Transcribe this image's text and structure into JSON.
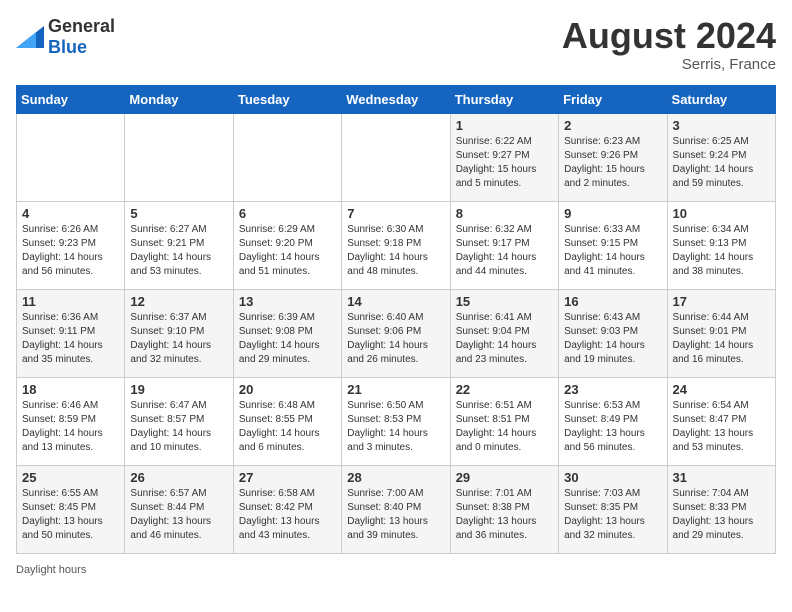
{
  "header": {
    "logo_general": "General",
    "logo_blue": "Blue",
    "month_year": "August 2024",
    "location": "Serris, France"
  },
  "days_of_week": [
    "Sunday",
    "Monday",
    "Tuesday",
    "Wednesday",
    "Thursday",
    "Friday",
    "Saturday"
  ],
  "weeks": [
    [
      {
        "day": "",
        "info": ""
      },
      {
        "day": "",
        "info": ""
      },
      {
        "day": "",
        "info": ""
      },
      {
        "day": "",
        "info": ""
      },
      {
        "day": "1",
        "info": "Sunrise: 6:22 AM\nSunset: 9:27 PM\nDaylight: 15 hours and 5 minutes."
      },
      {
        "day": "2",
        "info": "Sunrise: 6:23 AM\nSunset: 9:26 PM\nDaylight: 15 hours and 2 minutes."
      },
      {
        "day": "3",
        "info": "Sunrise: 6:25 AM\nSunset: 9:24 PM\nDaylight: 14 hours and 59 minutes."
      }
    ],
    [
      {
        "day": "4",
        "info": "Sunrise: 6:26 AM\nSunset: 9:23 PM\nDaylight: 14 hours and 56 minutes."
      },
      {
        "day": "5",
        "info": "Sunrise: 6:27 AM\nSunset: 9:21 PM\nDaylight: 14 hours and 53 minutes."
      },
      {
        "day": "6",
        "info": "Sunrise: 6:29 AM\nSunset: 9:20 PM\nDaylight: 14 hours and 51 minutes."
      },
      {
        "day": "7",
        "info": "Sunrise: 6:30 AM\nSunset: 9:18 PM\nDaylight: 14 hours and 48 minutes."
      },
      {
        "day": "8",
        "info": "Sunrise: 6:32 AM\nSunset: 9:17 PM\nDaylight: 14 hours and 44 minutes."
      },
      {
        "day": "9",
        "info": "Sunrise: 6:33 AM\nSunset: 9:15 PM\nDaylight: 14 hours and 41 minutes."
      },
      {
        "day": "10",
        "info": "Sunrise: 6:34 AM\nSunset: 9:13 PM\nDaylight: 14 hours and 38 minutes."
      }
    ],
    [
      {
        "day": "11",
        "info": "Sunrise: 6:36 AM\nSunset: 9:11 PM\nDaylight: 14 hours and 35 minutes."
      },
      {
        "day": "12",
        "info": "Sunrise: 6:37 AM\nSunset: 9:10 PM\nDaylight: 14 hours and 32 minutes."
      },
      {
        "day": "13",
        "info": "Sunrise: 6:39 AM\nSunset: 9:08 PM\nDaylight: 14 hours and 29 minutes."
      },
      {
        "day": "14",
        "info": "Sunrise: 6:40 AM\nSunset: 9:06 PM\nDaylight: 14 hours and 26 minutes."
      },
      {
        "day": "15",
        "info": "Sunrise: 6:41 AM\nSunset: 9:04 PM\nDaylight: 14 hours and 23 minutes."
      },
      {
        "day": "16",
        "info": "Sunrise: 6:43 AM\nSunset: 9:03 PM\nDaylight: 14 hours and 19 minutes."
      },
      {
        "day": "17",
        "info": "Sunrise: 6:44 AM\nSunset: 9:01 PM\nDaylight: 14 hours and 16 minutes."
      }
    ],
    [
      {
        "day": "18",
        "info": "Sunrise: 6:46 AM\nSunset: 8:59 PM\nDaylight: 14 hours and 13 minutes."
      },
      {
        "day": "19",
        "info": "Sunrise: 6:47 AM\nSunset: 8:57 PM\nDaylight: 14 hours and 10 minutes."
      },
      {
        "day": "20",
        "info": "Sunrise: 6:48 AM\nSunset: 8:55 PM\nDaylight: 14 hours and 6 minutes."
      },
      {
        "day": "21",
        "info": "Sunrise: 6:50 AM\nSunset: 8:53 PM\nDaylight: 14 hours and 3 minutes."
      },
      {
        "day": "22",
        "info": "Sunrise: 6:51 AM\nSunset: 8:51 PM\nDaylight: 14 hours and 0 minutes."
      },
      {
        "day": "23",
        "info": "Sunrise: 6:53 AM\nSunset: 8:49 PM\nDaylight: 13 hours and 56 minutes."
      },
      {
        "day": "24",
        "info": "Sunrise: 6:54 AM\nSunset: 8:47 PM\nDaylight: 13 hours and 53 minutes."
      }
    ],
    [
      {
        "day": "25",
        "info": "Sunrise: 6:55 AM\nSunset: 8:45 PM\nDaylight: 13 hours and 50 minutes."
      },
      {
        "day": "26",
        "info": "Sunrise: 6:57 AM\nSunset: 8:44 PM\nDaylight: 13 hours and 46 minutes."
      },
      {
        "day": "27",
        "info": "Sunrise: 6:58 AM\nSunset: 8:42 PM\nDaylight: 13 hours and 43 minutes."
      },
      {
        "day": "28",
        "info": "Sunrise: 7:00 AM\nSunset: 8:40 PM\nDaylight: 13 hours and 39 minutes."
      },
      {
        "day": "29",
        "info": "Sunrise: 7:01 AM\nSunset: 8:38 PM\nDaylight: 13 hours and 36 minutes."
      },
      {
        "day": "30",
        "info": "Sunrise: 7:03 AM\nSunset: 8:35 PM\nDaylight: 13 hours and 32 minutes."
      },
      {
        "day": "31",
        "info": "Sunrise: 7:04 AM\nSunset: 8:33 PM\nDaylight: 13 hours and 29 minutes."
      }
    ]
  ],
  "footer": {
    "daylight_label": "Daylight hours"
  }
}
